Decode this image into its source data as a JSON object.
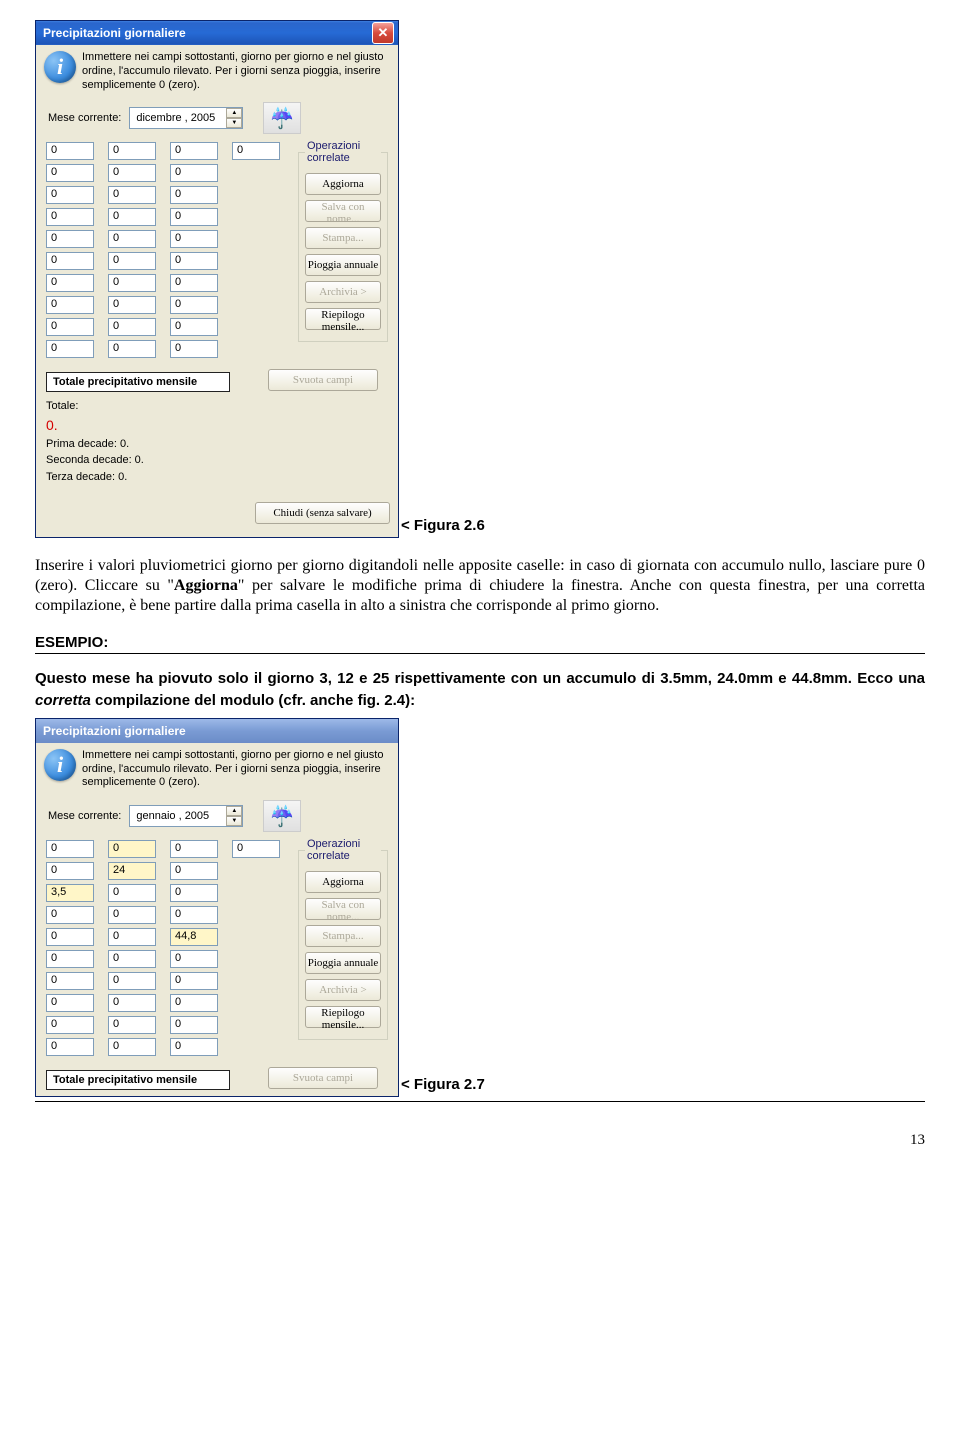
{
  "dialog1": {
    "title": "Precipitazioni giornaliere",
    "info": "Immettere nei campi sottostanti, giorno per giorno e nel giusto ordine, l'accumulo rilevato. Per i giorni senza pioggia, inserire semplicemente 0 (zero).",
    "meseLabel": "Mese corrente:",
    "meseValue": "dicembre , 2005",
    "gridCols": [
      [
        "0",
        "0",
        "0",
        "0",
        "0",
        "0",
        "0",
        "0",
        "0",
        "0"
      ],
      [
        "0",
        "0",
        "0",
        "0",
        "0",
        "0",
        "0",
        "0",
        "0",
        "0"
      ],
      [
        "0",
        "0",
        "0",
        "0",
        "0",
        "0",
        "0",
        "0",
        "0",
        "0"
      ],
      [
        "0"
      ]
    ],
    "opsTitle": "Operazioni correlate",
    "btns": {
      "aggiorna": "Aggiorna",
      "salva": "Salva con nome...",
      "stampa": "Stampa...",
      "pioggia": "Pioggia annuale",
      "archivia": "Archivia >",
      "riepilogo": "Riepilogo mensile..."
    },
    "totalBox": "Totale precipitativo mensile",
    "svuota": "Svuota campi",
    "totals": {
      "totLabel": "Totale:",
      "totVal": "0.",
      "prima": "Prima decade: 0.",
      "seconda": "Seconda decade: 0.",
      "terza": "Terza decade: 0."
    },
    "chiudi": "Chiudi (senza salvare)"
  },
  "caption1": "< Figura 2.6",
  "para1": "Inserire i valori pluviometrici giorno per giorno digitandoli nelle apposite caselle: in caso di giornata con accumulo nullo, lasciare pure 0 (zero). Cliccare su \"Aggiorna\" per salvare le modifiche prima di chiudere la finestra. Anche con questa finestra, per una corretta compilazione, è bene partire dalla prima casella in alto a sinistra che corrisponde al primo giorno.",
  "exampleHeading": "ESEMPIO:",
  "exampleBody": "Questo mese ha piovuto solo il giorno 3, 12 e 25 rispettivamente con un accumulo di 3.5mm, 24.0mm e 44.8mm. Ecco una ",
  "exampleItalic": "corretta",
  "exampleTail": " compilazione del modulo (cfr. anche fig. 2.4):",
  "dialog2": {
    "title": "Precipitazioni giornaliere",
    "info": "Immettere nei campi sottostanti, giorno per giorno e nel giusto ordine, l'accumulo rilevato. Per i giorni senza pioggia, inserire semplicemente 0 (zero).",
    "meseLabel": "Mese corrente:",
    "meseValue": "gennaio , 2005",
    "gridCols": [
      [
        "0",
        "0",
        "3,5",
        "0",
        "0",
        "0",
        "0",
        "0",
        "0",
        "0"
      ],
      [
        "0",
        "24",
        "0",
        "0",
        "0",
        "0",
        "0",
        "0",
        "0",
        "0"
      ],
      [
        "0",
        "0",
        "0",
        "0",
        "44,8",
        "0",
        "0",
        "0",
        "0",
        "0"
      ],
      [
        "0"
      ]
    ],
    "highlights": {
      "r0c1": true,
      "r1c1": true,
      "r2c0": true,
      "r4c2": true
    },
    "opsTitle": "Operazioni correlate",
    "btns": {
      "aggiorna": "Aggiorna",
      "salva": "Salva con nome...",
      "stampa": "Stampa...",
      "pioggia": "Pioggia annuale",
      "archivia": "Archivia >",
      "riepilogo": "Riepilogo mensile..."
    },
    "totalBox": "Totale precipitativo mensile",
    "svuota": "Svuota campi"
  },
  "caption2": "< Figura 2.7",
  "pageNum": "13"
}
